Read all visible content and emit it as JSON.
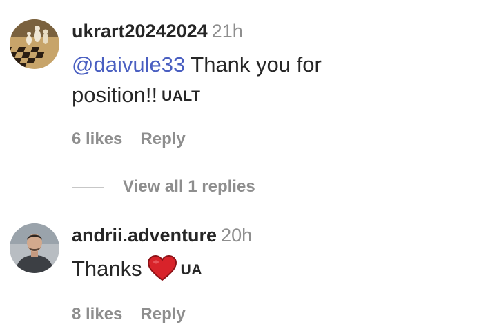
{
  "comments": [
    {
      "username": "ukrart20242024",
      "time": "21h",
      "mention": "@daivule33",
      "text_line1": " Thank you for",
      "text_line2": "position!!",
      "flag_code": "UALT",
      "likes": "6 likes",
      "reply": "Reply",
      "avatar_icon": "chess-board-avatar"
    },
    {
      "username": "andrii.adventure",
      "time": "20h",
      "text": "Thanks",
      "emoji": "red-heart-icon",
      "flag_code": "UA",
      "likes": "8 likes",
      "reply": "Reply",
      "avatar_icon": "person-photo-avatar"
    }
  ],
  "view_replies": "View all 1 replies",
  "colors": {
    "text": "#262626",
    "muted": "#8e8e8e",
    "mention": "#4a5fc1",
    "heart": "#d8232a"
  }
}
